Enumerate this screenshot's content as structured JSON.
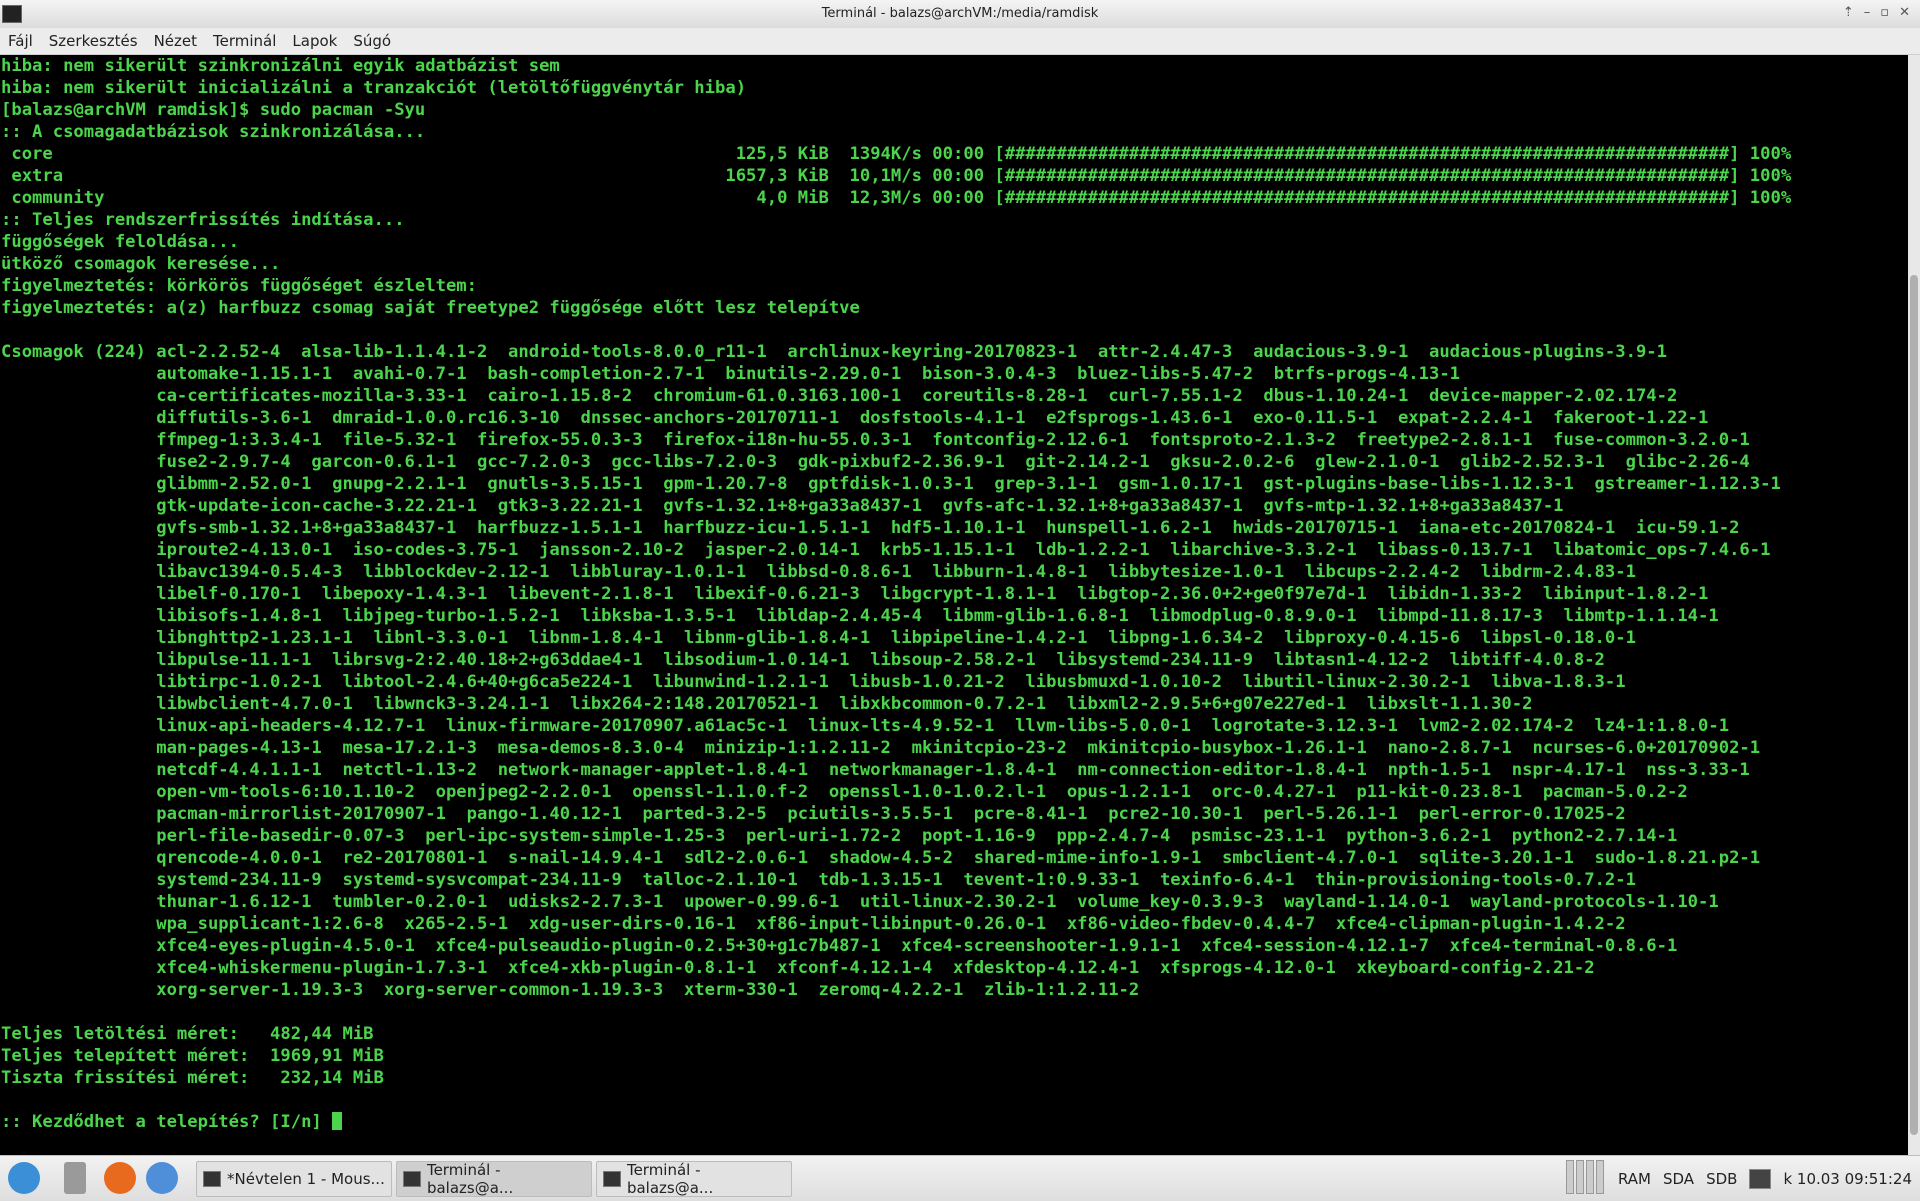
{
  "window": {
    "title": "Terminál - balazs@archVM:/media/ramdisk"
  },
  "menu": [
    "Fájl",
    "Szerkesztés",
    "Nézet",
    "Terminál",
    "Lapok",
    "Súgó"
  ],
  "terminal": {
    "lines": [
      "hiba: nem sikerült szinkronizálni egyik adatbázist sem",
      "hiba: nem sikerült inicializálni a tranzakciót (letöltőfüggvénytár hiba)",
      "[balazs@archVM ramdisk]$ sudo pacman -Syu",
      ":: A csomagadatbázisok szinkronizálása...",
      " core                                                                  125,5 KiB  1394K/s 00:00 [######################################################################] 100%",
      " extra                                                                1657,3 KiB  10,1M/s 00:00 [######################################################################] 100%",
      " community                                                               4,0 MiB  12,3M/s 00:00 [######################################################################] 100%",
      ":: Teljes rendszerfrissítés indítása...",
      "függőségek feloldása...",
      "ütköző csomagok keresése...",
      "figyelmeztetés: körkörös függőséget észleltem:",
      "figyelmeztetés: a(z) harfbuzz csomag saját freetype2 függősége előtt lesz telepítve",
      "",
      "Csomagok (224) acl-2.2.52-4  alsa-lib-1.1.4.1-2  android-tools-8.0.0_r11-1  archlinux-keyring-20170823-1  attr-2.4.47-3  audacious-3.9-1  audacious-plugins-3.9-1",
      "               automake-1.15.1-1  avahi-0.7-1  bash-completion-2.7-1  binutils-2.29.0-1  bison-3.0.4-3  bluez-libs-5.47-2  btrfs-progs-4.13-1",
      "               ca-certificates-mozilla-3.33-1  cairo-1.15.8-2  chromium-61.0.3163.100-1  coreutils-8.28-1  curl-7.55.1-2  dbus-1.10.24-1  device-mapper-2.02.174-2",
      "               diffutils-3.6-1  dmraid-1.0.0.rc16.3-10  dnssec-anchors-20170711-1  dosfstools-4.1-1  e2fsprogs-1.43.6-1  exo-0.11.5-1  expat-2.2.4-1  fakeroot-1.22-1",
      "               ffmpeg-1:3.3.4-1  file-5.32-1  firefox-55.0.3-3  firefox-i18n-hu-55.0.3-1  fontconfig-2.12.6-1  fontsproto-2.1.3-2  freetype2-2.8.1-1  fuse-common-3.2.0-1",
      "               fuse2-2.9.7-4  garcon-0.6.1-1  gcc-7.2.0-3  gcc-libs-7.2.0-3  gdk-pixbuf2-2.36.9-1  git-2.14.2-1  gksu-2.0.2-6  glew-2.1.0-1  glib2-2.52.3-1  glibc-2.26-4",
      "               glibmm-2.52.0-1  gnupg-2.2.1-1  gnutls-3.5.15-1  gpm-1.20.7-8  gptfdisk-1.0.3-1  grep-3.1-1  gsm-1.0.17-1  gst-plugins-base-libs-1.12.3-1  gstreamer-1.12.3-1",
      "               gtk-update-icon-cache-3.22.21-1  gtk3-3.22.21-1  gvfs-1.32.1+8+ga33a8437-1  gvfs-afc-1.32.1+8+ga33a8437-1  gvfs-mtp-1.32.1+8+ga33a8437-1",
      "               gvfs-smb-1.32.1+8+ga33a8437-1  harfbuzz-1.5.1-1  harfbuzz-icu-1.5.1-1  hdf5-1.10.1-1  hunspell-1.6.2-1  hwids-20170715-1  iana-etc-20170824-1  icu-59.1-2",
      "               iproute2-4.13.0-1  iso-codes-3.75-1  jansson-2.10-2  jasper-2.0.14-1  krb5-1.15.1-1  ldb-1.2.2-1  libarchive-3.3.2-1  libass-0.13.7-1  libatomic_ops-7.4.6-1",
      "               libavc1394-0.5.4-3  libblockdev-2.12-1  libbluray-1.0.1-1  libbsd-0.8.6-1  libburn-1.4.8-1  libbytesize-1.0-1  libcups-2.2.4-2  libdrm-2.4.83-1",
      "               libelf-0.170-1  libepoxy-1.4.3-1  libevent-2.1.8-1  libexif-0.6.21-3  libgcrypt-1.8.1-1  libgtop-2.36.0+2+ge0f97e7d-1  libidn-1.33-2  libinput-1.8.2-1",
      "               libisofs-1.4.8-1  libjpeg-turbo-1.5.2-1  libksba-1.3.5-1  libldap-2.4.45-4  libmm-glib-1.6.8-1  libmodplug-0.8.9.0-1  libmpd-11.8.17-3  libmtp-1.1.14-1",
      "               libnghttp2-1.23.1-1  libnl-3.3.0-1  libnm-1.8.4-1  libnm-glib-1.8.4-1  libpipeline-1.4.2-1  libpng-1.6.34-2  libproxy-0.4.15-6  libpsl-0.18.0-1",
      "               libpulse-11.1-1  librsvg-2:2.40.18+2+g63ddae4-1  libsodium-1.0.14-1  libsoup-2.58.2-1  libsystemd-234.11-9  libtasn1-4.12-2  libtiff-4.0.8-2",
      "               libtirpc-1.0.2-1  libtool-2.4.6+40+g6ca5e224-1  libunwind-1.2.1-1  libusb-1.0.21-2  libusbmuxd-1.0.10-2  libutil-linux-2.30.2-1  libva-1.8.3-1",
      "               libwbclient-4.7.0-1  libwnck3-3.24.1-1  libx264-2:148.20170521-1  libxkbcommon-0.7.2-1  libxml2-2.9.5+6+g07e227ed-1  libxslt-1.1.30-2",
      "               linux-api-headers-4.12.7-1  linux-firmware-20170907.a61ac5c-1  linux-lts-4.9.52-1  llvm-libs-5.0.0-1  logrotate-3.12.3-1  lvm2-2.02.174-2  lz4-1:1.8.0-1",
      "               man-pages-4.13-1  mesa-17.2.1-3  mesa-demos-8.3.0-4  minizip-1:1.2.11-2  mkinitcpio-23-2  mkinitcpio-busybox-1.26.1-1  nano-2.8.7-1  ncurses-6.0+20170902-1",
      "               netcdf-4.4.1.1-1  netctl-1.13-2  network-manager-applet-1.8.4-1  networkmanager-1.8.4-1  nm-connection-editor-1.8.4-1  npth-1.5-1  nspr-4.17-1  nss-3.33-1",
      "               open-vm-tools-6:10.1.10-2  openjpeg2-2.2.0-1  openssl-1.1.0.f-2  openssl-1.0-1.0.2.l-1  opus-1.2.1-1  orc-0.4.27-1  p11-kit-0.23.8-1  pacman-5.0.2-2",
      "               pacman-mirrorlist-20170907-1  pango-1.40.12-1  parted-3.2-5  pciutils-3.5.5-1  pcre-8.41-1  pcre2-10.30-1  perl-5.26.1-1  perl-error-0.17025-2",
      "               perl-file-basedir-0.07-3  perl-ipc-system-simple-1.25-3  perl-uri-1.72-2  popt-1.16-9  ppp-2.4.7-4  psmisc-23.1-1  python-3.6.2-1  python2-2.7.14-1",
      "               qrencode-4.0.0-1  re2-20170801-1  s-nail-14.9.4-1  sdl2-2.0.6-1  shadow-4.5-2  shared-mime-info-1.9-1  smbclient-4.7.0-1  sqlite-3.20.1-1  sudo-1.8.21.p2-1",
      "               systemd-234.11-9  systemd-sysvcompat-234.11-9  talloc-2.1.10-1  tdb-1.3.15-1  tevent-1:0.9.33-1  texinfo-6.4-1  thin-provisioning-tools-0.7.2-1",
      "               thunar-1.6.12-1  tumbler-0.2.0-1  udisks2-2.7.3-1  upower-0.99.6-1  util-linux-2.30.2-1  volume_key-0.3.9-3  wayland-1.14.0-1  wayland-protocols-1.10-1",
      "               wpa_supplicant-1:2.6-8  x265-2.5-1  xdg-user-dirs-0.16-1  xf86-input-libinput-0.26.0-1  xf86-video-fbdev-0.4.4-7  xfce4-clipman-plugin-1.4.2-2",
      "               xfce4-eyes-plugin-4.5.0-1  xfce4-pulseaudio-plugin-0.2.5+30+g1c7b487-1  xfce4-screenshooter-1.9.1-1  xfce4-session-4.12.1-7  xfce4-terminal-0.8.6-1",
      "               xfce4-whiskermenu-plugin-1.7.3-1  xfce4-xkb-plugin-0.8.1-1  xfconf-4.12.1-4  xfdesktop-4.12.4-1  xfsprogs-4.12.0-1  xkeyboard-config-2.21-2",
      "               xorg-server-1.19.3-3  xorg-server-common-1.19.3-3  xterm-330-1  zeromq-4.2.2-1  zlib-1:1.2.11-2",
      "",
      "Teljes letöltési méret:   482,44 MiB",
      "Teljes telepített méret:  1969,91 MiB",
      "Tiszta frissítési méret:   232,14 MiB",
      ""
    ],
    "prompt": ":: Kezdődhet a telepítés? [I/n] "
  },
  "taskbar": {
    "tasks": [
      "*Névtelen 1 - Mous...",
      "Terminál - balazs@a...",
      "Terminál - balazs@a..."
    ],
    "indicators": [
      "RAM",
      "SDA",
      "SDB"
    ],
    "clock": "k 10.03 09:51:24"
  }
}
